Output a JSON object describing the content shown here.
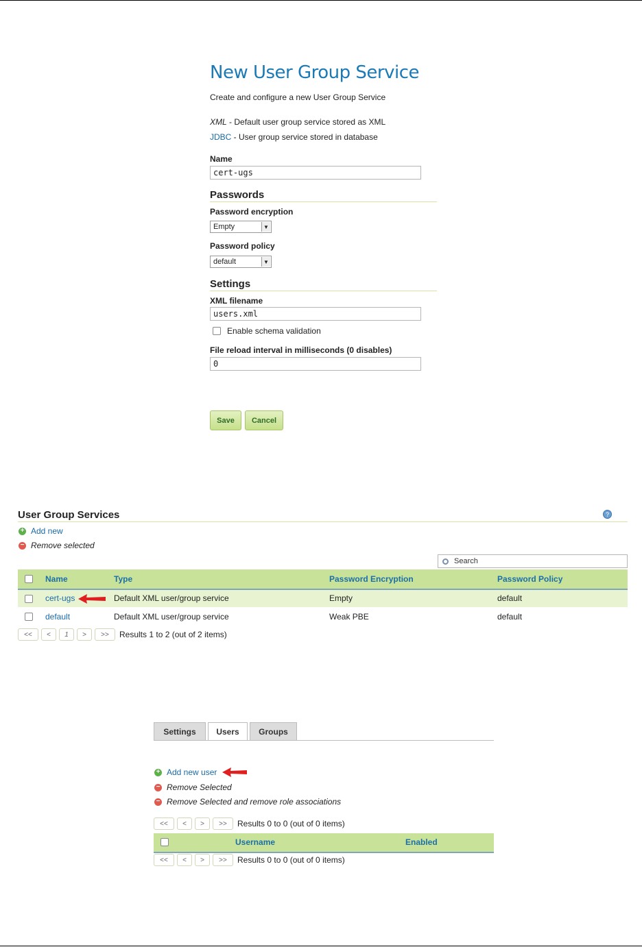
{
  "form": {
    "title": "New User Group Service",
    "subtitle": "Create and configure a new User Group Service",
    "xml_desc_label": "XML",
    "xml_desc_text": " - Default user group service stored as XML",
    "jdbc_link": "JDBC",
    "jdbc_desc_text": " - User group service stored in database",
    "name_label": "Name",
    "name_value": "cert-ugs",
    "passwords_heading": "Passwords",
    "password_encryption_label": "Password encryption",
    "password_encryption_value": "Empty",
    "password_policy_label": "Password policy",
    "password_policy_value": "default",
    "settings_heading": "Settings",
    "xml_filename_label": "XML filename",
    "xml_filename_value": "users.xml",
    "schema_validation_label": "Enable schema validation",
    "reload_label": "File reload interval in milliseconds (0 disables)",
    "reload_value": "0",
    "save_label": "Save",
    "cancel_label": "Cancel"
  },
  "services": {
    "heading": "User Group Services",
    "add_new": "Add new",
    "remove_selected": "Remove selected",
    "search_placeholder": "Search",
    "columns": [
      "Name",
      "Type",
      "Password Encryption",
      "Password Policy"
    ],
    "rows": [
      {
        "name": "cert-ugs",
        "type": "Default XML user/group service",
        "encryption": "Empty",
        "policy": "default"
      },
      {
        "name": "default",
        "type": "Default XML user/group service",
        "encryption": "Weak PBE",
        "policy": "default"
      }
    ],
    "pager": {
      "first": "<<",
      "prev": "<",
      "page": "1",
      "next": ">",
      "last": ">>",
      "summary": "Results 1 to 2 (out of 2 items)"
    }
  },
  "users_panel": {
    "tabs": [
      "Settings",
      "Users",
      "Groups"
    ],
    "active_tab": "Users",
    "add_new_user": "Add new user",
    "remove_selected": "Remove Selected",
    "remove_with_roles": "Remove Selected and remove role associations",
    "columns": [
      "Username",
      "Enabled"
    ],
    "pager": {
      "first": "<<",
      "prev": "<",
      "next": ">",
      "last": ">>",
      "summary": "Results 0 to 0 (out of 0 items)"
    }
  },
  "colors": {
    "title_blue": "#1b7ab5",
    "header_green": "#c9e29a",
    "arrow_red": "#e02020"
  }
}
